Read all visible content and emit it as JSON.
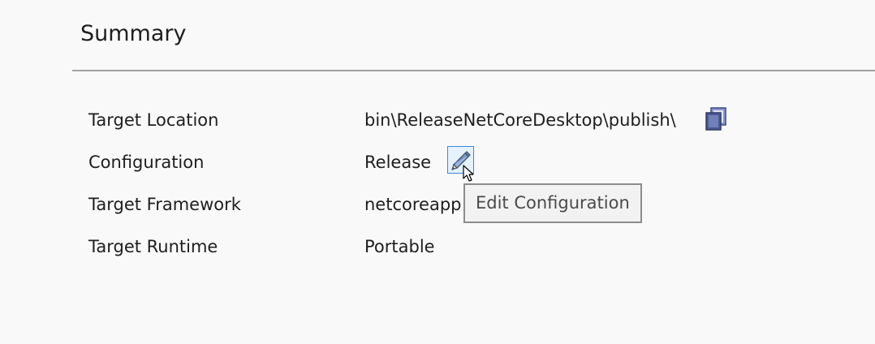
{
  "summary": {
    "title": "Summary",
    "rows": [
      {
        "label": "Target Location",
        "value": "bin\\ReleaseNetCoreDesktop\\publish\\"
      },
      {
        "label": "Configuration",
        "value": "Release"
      },
      {
        "label": "Target Framework",
        "value": "netcoreapp"
      },
      {
        "label": "Target Runtime",
        "value": "Portable"
      }
    ]
  },
  "tooltip": {
    "text": "Edit Configuration"
  },
  "icons": {
    "copy": "copy-icon",
    "edit": "pencil-icon"
  },
  "colors": {
    "background": "#f9f9f9",
    "icon_accent": "#4b5a94",
    "edit_button_border": "#3b8ad7",
    "edit_button_background": "#e5f1fb"
  }
}
